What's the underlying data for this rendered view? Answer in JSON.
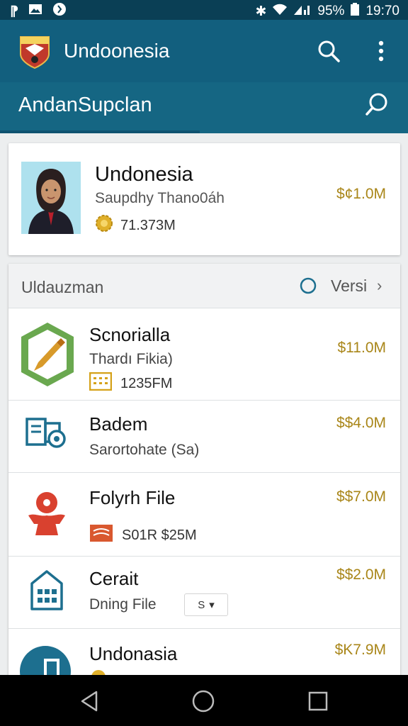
{
  "status_bar": {
    "battery": "95%",
    "time": "19:70"
  },
  "app_bar": {
    "title": "Undoonesia"
  },
  "sub_bar": {
    "title": "AndanSupclan"
  },
  "profile": {
    "name": "Undonesia",
    "subtitle": "Saupdhy Thano0áh",
    "meta": "71.373M",
    "price": "$¢1.0M"
  },
  "list": {
    "header_title": "Uldauzman",
    "header_action": "Versi",
    "items": [
      {
        "name": "Scnorialla",
        "subtitle": "Thardı Fikia)",
        "meta": "1235FM",
        "price": "$11.0M"
      },
      {
        "name": "Badem",
        "subtitle": "Sarortohate (Sa)",
        "price": "$$4.0M"
      },
      {
        "name": "Folyrh File",
        "meta": "S01R $25M",
        "price": "$$7.0M"
      },
      {
        "name": "Cerait",
        "subtitle": "Dning File",
        "dropdown": "S",
        "price": "$$2.0M"
      },
      {
        "name": "Undonasia",
        "price": "$K7.9M"
      }
    ]
  },
  "colors": {
    "primary": "#125f7e",
    "accent_price": "#a98619",
    "status_bar": "#0a3f55"
  }
}
